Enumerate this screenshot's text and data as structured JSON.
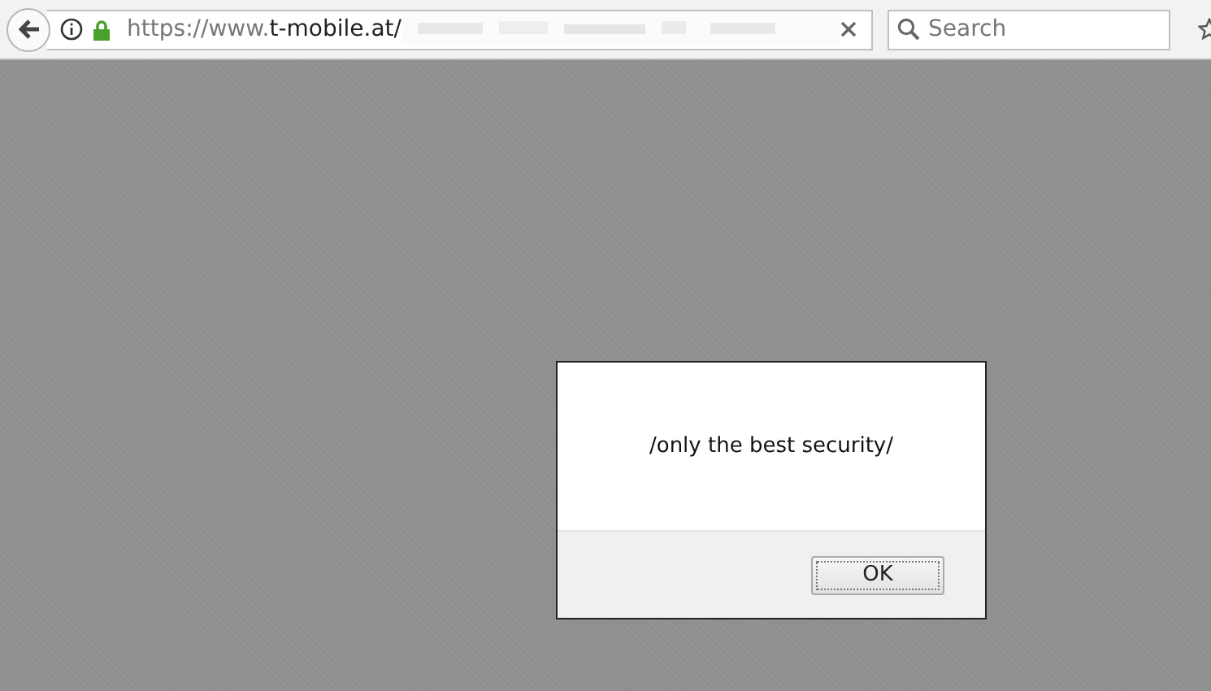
{
  "address_bar": {
    "scheme": "https://www.",
    "host": "t-mobile.at/"
  },
  "search": {
    "placeholder": "Search"
  },
  "dialog": {
    "message": "/only the best security/",
    "button": "OK"
  }
}
